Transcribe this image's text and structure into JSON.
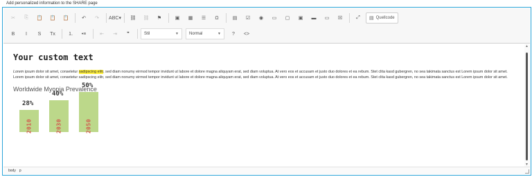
{
  "page": {
    "title": "Add personalized information to the SHARE page"
  },
  "toolbar": {
    "row1": [
      {
        "name": "cut-icon",
        "glyph": "✂",
        "disabled": true
      },
      {
        "name": "copy-icon",
        "glyph": "⎘",
        "disabled": true
      },
      {
        "name": "paste-icon",
        "glyph": "📋",
        "disabled": false
      },
      {
        "name": "paste-text-icon",
        "glyph": "📋",
        "disabled": false
      },
      {
        "name": "paste-word-icon",
        "glyph": "📋",
        "disabled": false
      },
      {
        "name": "undo-icon",
        "glyph": "↶",
        "disabled": false
      },
      {
        "name": "redo-icon",
        "glyph": "↷",
        "disabled": true
      },
      {
        "name": "spellcheck-icon",
        "glyph": "ABC▾",
        "disabled": false
      },
      {
        "name": "link-icon",
        "glyph": "⛓",
        "disabled": false
      },
      {
        "name": "unlink-icon",
        "glyph": "⛓",
        "disabled": true
      },
      {
        "name": "anchor-icon",
        "glyph": "⚑",
        "disabled": false
      },
      {
        "name": "image-icon",
        "glyph": "▣",
        "disabled": false
      },
      {
        "name": "table-icon",
        "glyph": "▦",
        "disabled": false
      },
      {
        "name": "horizontal-line-icon",
        "glyph": "☰",
        "disabled": false
      },
      {
        "name": "special-char-icon",
        "glyph": "Ω",
        "disabled": false
      },
      {
        "name": "form-icon",
        "glyph": "▤",
        "disabled": false
      },
      {
        "name": "checkbox-icon",
        "glyph": "☑",
        "disabled": false
      },
      {
        "name": "radio-icon",
        "glyph": "◉",
        "disabled": false
      },
      {
        "name": "textfield-icon",
        "glyph": "▭",
        "disabled": false
      },
      {
        "name": "textarea-icon",
        "glyph": "▢",
        "disabled": false
      },
      {
        "name": "select-icon",
        "glyph": "▣",
        "disabled": false
      },
      {
        "name": "button-icon",
        "glyph": "▬",
        "disabled": false
      },
      {
        "name": "image-button-icon",
        "glyph": "▭",
        "disabled": false
      },
      {
        "name": "hidden-field-icon",
        "glyph": "☒",
        "disabled": false
      },
      {
        "name": "maximize-icon",
        "glyph": "⤢",
        "disabled": false
      }
    ],
    "source_button": "Quellcode",
    "row2": [
      {
        "name": "bold-icon",
        "glyph": "B",
        "disabled": false
      },
      {
        "name": "italic-icon",
        "glyph": "I",
        "disabled": false
      },
      {
        "name": "strikethrough-icon",
        "glyph": "S",
        "disabled": false
      },
      {
        "name": "remove-format-icon",
        "glyph": "Tx",
        "disabled": false
      },
      {
        "name": "numbered-list-icon",
        "glyph": "⒈",
        "disabled": false
      },
      {
        "name": "bulleted-list-icon",
        "glyph": "•≡",
        "disabled": false
      },
      {
        "name": "outdent-icon",
        "glyph": "⇤",
        "disabled": true
      },
      {
        "name": "indent-icon",
        "glyph": "⇥",
        "disabled": true
      },
      {
        "name": "blockquote-icon",
        "glyph": "❞",
        "disabled": false
      }
    ],
    "style_select": "Stil",
    "format_select": "Normal",
    "help_icon": "?",
    "source_icon": "<>"
  },
  "content": {
    "heading": "Your custom text",
    "para_lead": "Lorem ipsum",
    "para_a": " dolor sit amet, consetetur ",
    "para_highlight": "sadipscing elitr",
    "para_b": ", sed diam nonumy eirmod tempor invidunt ut labore et dolore magna aliquyam erat, sed diam voluptua. At vero eos et accusam et justo duo dolores et ea rebum. Stet clita kasd gubergren, no sea takimata sanctus est Lorem ipsum dolor sit amet. Lorem ipsum dolor sit amet, consetetur sadipscing elitr, sed diam nonumy eirmod tempor invidunt ut labore et dolore magna aliquyam erat, sed diam voluptua. At vero eos et accusam et justo duo dolores et ea rebum. Stet clita kasd gubergren, no sea takimata sanctus est Lorem ipsum dolor sit amet.",
    "chart_title": "Worldwide Myopia Prevalence"
  },
  "chart_data": {
    "type": "bar",
    "title": "Worldwide Myopia Prevalence",
    "categories": [
      "2010",
      "2030",
      "2050"
    ],
    "values": [
      28,
      40,
      50
    ],
    "labels": [
      "28%",
      "40%",
      "50%"
    ],
    "ylim": [
      0,
      60
    ],
    "bar_color": "#bcd88a",
    "category_color": "#d25a4e"
  },
  "statusbar": {
    "path": [
      "body",
      "p"
    ]
  },
  "colors": {
    "accent": "#2aa4d8",
    "highlight": "#ffef3b"
  }
}
